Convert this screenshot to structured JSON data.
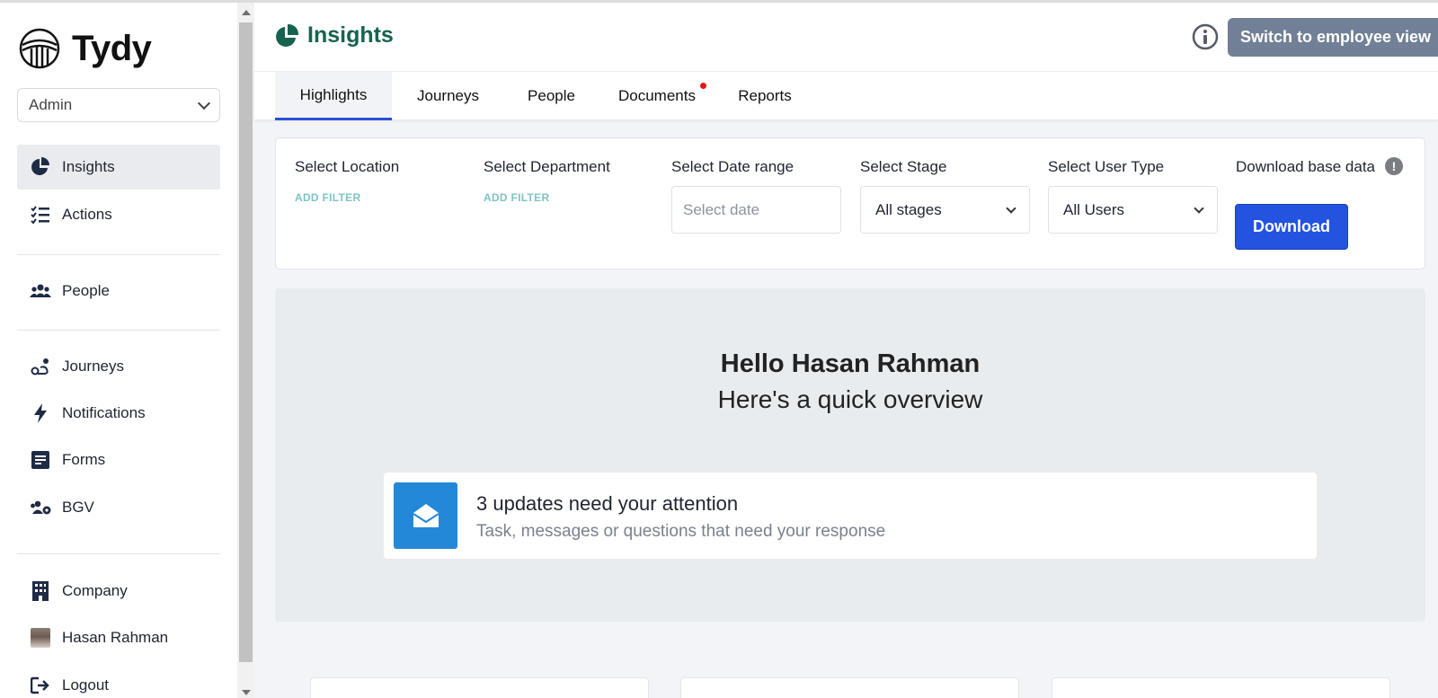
{
  "app": {
    "name": "Tydy"
  },
  "sidebar": {
    "role": "Admin",
    "items": [
      {
        "label": "Insights",
        "icon": "pie-chart-icon"
      },
      {
        "label": "Actions",
        "icon": "checklist-icon"
      },
      {
        "label": "People",
        "icon": "users-icon"
      },
      {
        "label": "Journeys",
        "icon": "route-icon"
      },
      {
        "label": "Notifications",
        "icon": "bolt-icon"
      },
      {
        "label": "Forms",
        "icon": "form-icon"
      },
      {
        "label": "BGV",
        "icon": "users-gear-icon"
      },
      {
        "label": "Company",
        "icon": "building-icon"
      },
      {
        "label": "Hasan Rahman",
        "icon": "avatar"
      },
      {
        "label": "Logout",
        "icon": "logout-icon"
      }
    ]
  },
  "header": {
    "title": "Insights",
    "switch_label": "Switch to employee view"
  },
  "tabs": [
    {
      "label": "Highlights",
      "active": true
    },
    {
      "label": "Journeys"
    },
    {
      "label": "People"
    },
    {
      "label": "Documents",
      "notification_dot": true
    },
    {
      "label": "Reports"
    }
  ],
  "filters": {
    "location": {
      "label": "Select Location",
      "action": "ADD FILTER"
    },
    "department": {
      "label": "Select Department",
      "action": "ADD FILTER"
    },
    "date_range": {
      "label": "Select Date range",
      "placeholder": "Select date"
    },
    "stage": {
      "label": "Select Stage",
      "value": "All stages"
    },
    "user_type": {
      "label": "Select User Type",
      "value": "All Users"
    },
    "download": {
      "label": "Download base data",
      "button": "Download"
    }
  },
  "overview": {
    "greeting": "Hello Hasan Rahman",
    "subtitle": "Here's a quick overview",
    "updates_title": "3 updates need your attention",
    "updates_sub": "Task, messages or questions that need your response"
  },
  "colors": {
    "brand_green": "#16634f",
    "primary_blue": "#2453e0",
    "switch_gray": "#718096",
    "update_icon_blue": "#2488d8",
    "teal_link": "#7fc3c4",
    "notification_red": "#e4151b"
  }
}
